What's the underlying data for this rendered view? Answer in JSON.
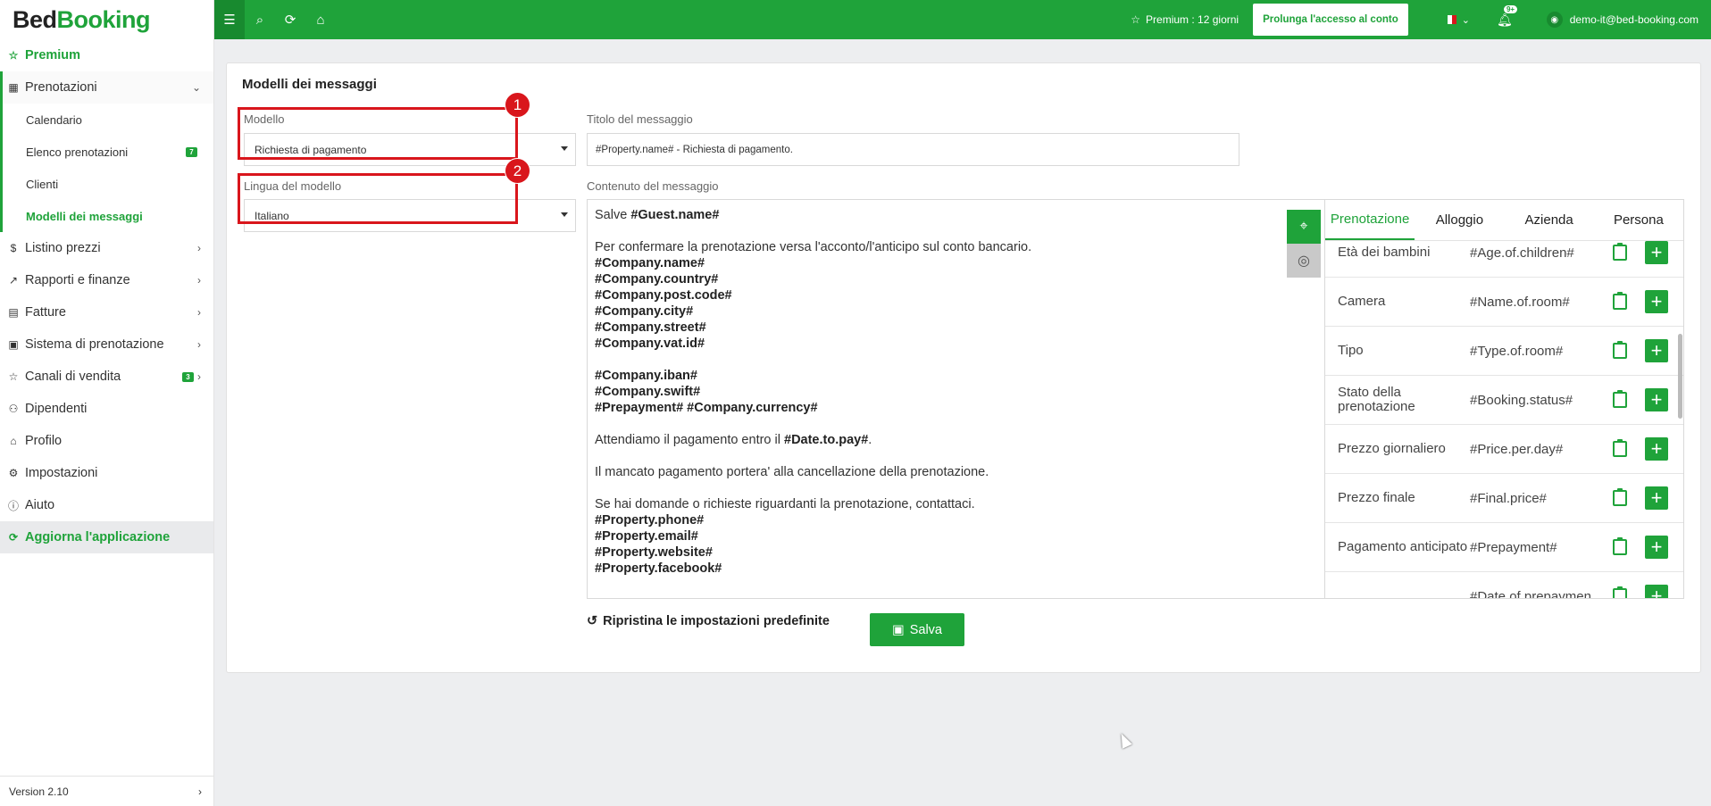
{
  "logo": {
    "part1": "Bed",
    "part2": "Booking"
  },
  "sidebar": {
    "premium": "Premium",
    "reservations": "Prenotazioni",
    "sub": [
      {
        "label": "Calendario",
        "badge": ""
      },
      {
        "label": "Elenco prenotazioni",
        "badge": "7"
      },
      {
        "label": "Clienti",
        "badge": ""
      },
      {
        "label": "Modelli dei messaggi",
        "badge": ""
      }
    ],
    "items": [
      {
        "label": "Listino prezzi",
        "icon": "dollar-icon",
        "badge": ""
      },
      {
        "label": "Rapporti e finanze",
        "icon": "chart-icon",
        "badge": ""
      },
      {
        "label": "Fatture",
        "icon": "invoice-icon",
        "badge": ""
      },
      {
        "label": "Sistema di prenotazione",
        "icon": "grid-icon",
        "badge": ""
      },
      {
        "label": "Canali di vendita",
        "icon": "star-icon",
        "badge": "3"
      },
      {
        "label": "Dipendenti",
        "icon": "user-plus-icon",
        "badge": ""
      },
      {
        "label": "Profilo",
        "icon": "building-icon",
        "badge": ""
      },
      {
        "label": "Impostazioni",
        "icon": "gear-icon",
        "badge": ""
      },
      {
        "label": "Aiuto",
        "icon": "info-icon",
        "badge": ""
      }
    ],
    "update": "Aggiorna l'applicazione",
    "version": "Version 2.10"
  },
  "topbar": {
    "premium": "Premium : 12 giorni",
    "extend": "Prolunga l'accesso al conto",
    "notifications": "9+",
    "user": "demo-it@bed-booking.com"
  },
  "page": {
    "title": "Modelli dei messaggi",
    "model_label": "Modello",
    "model_value": "Richiesta di pagamento",
    "lang_label": "Lingua del modello",
    "lang_value": "Italiano",
    "msg_title_label": "Titolo del messaggio",
    "msg_title_value": "#Property.name# - Richiesta di pagamento.",
    "content_label": "Contenuto del messaggio",
    "callout1": "1",
    "callout2": "2",
    "message": {
      "greet": "Salve ",
      "greet_var": "#Guest.name#",
      "l1": "Per confermare la prenotazione versa l'acconto/l'anticipo sul conto bancario.",
      "company": [
        "#Company.name#",
        "#Company.country#",
        "#Company.post.code#",
        "#Company.city#",
        "#Company.street#",
        "#Company.vat.id#"
      ],
      "bank": [
        "#Company.iban#",
        "#Company.swift#",
        "#Prepayment# #Company.currency#"
      ],
      "wait_pre": "Attendiamo il pagamento entro il ",
      "wait_var": "#Date.to.pay#",
      "wait_post": ".",
      "cancel": "Il mancato pagamento portera' alla cancellazione della prenotazione.",
      "contact": "Se hai domande o richieste riguardanti la prenotazione, contattaci.",
      "property": [
        "#Property.phone#",
        "#Property.email#",
        "#Property.website#",
        "#Property.facebook#"
      ]
    },
    "tabs": [
      "Prenotazione",
      "Alloggio",
      "Azienda",
      "Persona"
    ],
    "vars": [
      {
        "name": "Età dei bambini",
        "code": "#Age.of.children#"
      },
      {
        "name": "Camera",
        "code": "#Name.of.room#"
      },
      {
        "name": "Tipo",
        "code": "#Type.of.room#"
      },
      {
        "name": "Stato della prenotazione",
        "code": "#Booking.status#"
      },
      {
        "name": "Prezzo giornaliero",
        "code": "#Price.per.day#"
      },
      {
        "name": "Prezzo finale",
        "code": "#Final.price#"
      },
      {
        "name": "Pagamento anticipato",
        "code": "#Prepayment#"
      },
      {
        "name": "",
        "code": "#Date.of.prepaymen"
      }
    ],
    "restore": "Ripristina le impostazioni predefinite",
    "save": "Salva"
  }
}
